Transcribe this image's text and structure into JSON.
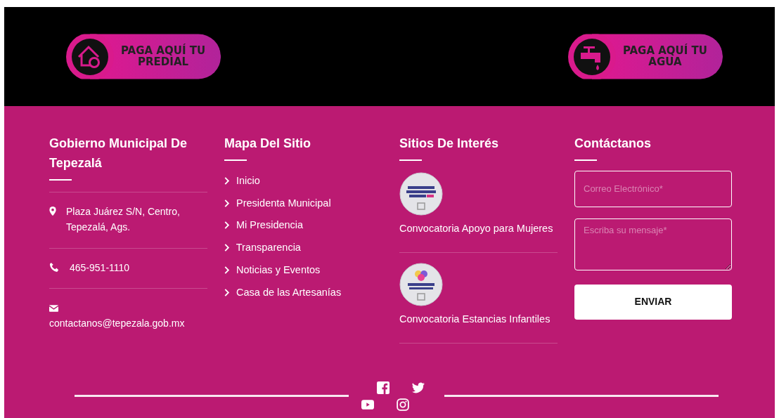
{
  "pay_buttons": [
    {
      "kind": "predial",
      "line1": "PAGA AQUÍ TU",
      "line2": "PREDIAL"
    },
    {
      "kind": "agua",
      "line1": "PAGA AQUÍ TU",
      "line2": "AGUA"
    }
  ],
  "about": {
    "title": "Gobierno Municipal De Tepezalá",
    "address": "Plaza Juárez S/N, Centro, Tepezalá, Ags.",
    "phone": "465-951-1110",
    "email": "contactanos@tepezala.gob.mx"
  },
  "sitemap": {
    "title": "Mapa Del Sitio",
    "links": [
      "Inicio",
      "Presidenta Municipal",
      "Mi Presidencia",
      "Transparencia",
      "Noticias y Eventos",
      "Casa de las Artesanías"
    ]
  },
  "sites": {
    "title": "Sitios De Interés",
    "items": [
      {
        "label": "Convocatoria Apoyo para Mujeres",
        "kind": "picture"
      },
      {
        "label": "Convocatoria Estancias Infantiles",
        "kind": "picture"
      }
    ]
  },
  "contact": {
    "title": "Contáctanos",
    "email_placeholder": "Correo Electrónico*",
    "message_placeholder": "Escriba su mensaje*",
    "submit": "ENVIAR"
  },
  "social": [
    {
      "kind": "facebook"
    },
    {
      "kind": "twitter"
    },
    {
      "kind": "youtube"
    },
    {
      "kind": "instagram"
    }
  ]
}
